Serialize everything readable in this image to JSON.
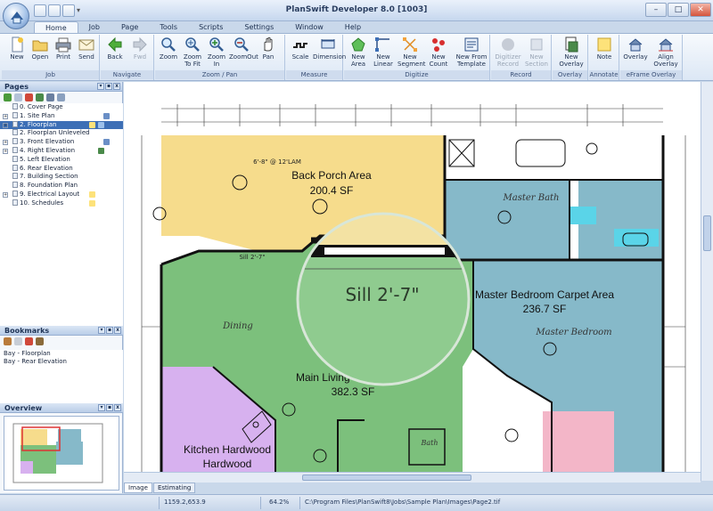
{
  "window": {
    "title": "PlanSwift Developer 8.0   [1003]",
    "minimize_label": "–",
    "maximize_label": "□",
    "close_label": "✕"
  },
  "tabs": [
    "Home",
    "Job",
    "Page",
    "Tools",
    "Scripts",
    "Settings",
    "Window",
    "Help"
  ],
  "ribbon": {
    "groups": {
      "job": "Job",
      "navigate": "Navigate",
      "zoompan": "Zoom / Pan",
      "measure": "Measure",
      "digitize": "Digitize",
      "record": "Record",
      "overlay": "Overlay",
      "annotate": "Annotate",
      "eframe": "eFrame Overlay"
    },
    "buttons": {
      "new": "New",
      "open": "Open",
      "print": "Print",
      "send": "Send",
      "back": "Back",
      "fwd": "Fwd",
      "zoom": "Zoom",
      "zoom_to_fit": "Zoom To Fit",
      "zoom_in": "Zoom In",
      "zoom_out": "ZoomOut",
      "pan": "Pan",
      "scale": "Scale",
      "dimension": "Dimension",
      "new_area": "New Area",
      "new_linear": "New Linear",
      "new_segment": "New Segment",
      "new_count": "New Count",
      "new_from_template": "New From Template",
      "digitizer_record": "Digitizer Record",
      "new_section": "New Section",
      "new_overlay": "New Overlay",
      "note": "Note",
      "overlay": "Overlay",
      "align_overlay": "Align Overlay"
    }
  },
  "pages_panel": {
    "title": "Pages",
    "items": [
      "0. Cover Page",
      "1. Site Plan",
      "2. Floorplan",
      "2. Floorplan Unleveled",
      "3. Front Elevation",
      "4. Right Elevation",
      "5. Left Elevation",
      "6. Rear Elevation",
      "7. Building Section",
      "8. Foundation Plan",
      "9. Electrical Layout",
      "10. Schedules"
    ]
  },
  "bookmarks_panel": {
    "title": "Bookmarks",
    "items": [
      "Bay - Floorplan",
      "Bay - Rear Elevation"
    ]
  },
  "overview_panel": {
    "title": "Overview"
  },
  "canvas": {
    "areas": [
      {
        "name": "Back Porch Area",
        "value": "200.4 SF"
      },
      {
        "name": "Master Bedroom Carpet Area",
        "value": "236.7 SF"
      },
      {
        "name": "Main Living Carpet Area",
        "value": "382.3 SF"
      },
      {
        "name": "Kitchen Hardwood",
        "value": ""
      }
    ],
    "magnifier_text": "Sill 2'-7\"",
    "plan_labels": {
      "master_bath": "Master Bath",
      "master_bedroom": "Master Bedroom",
      "dining": "Dining",
      "bath": "Bath",
      "porch_dim": "6'-8\" @ 12'LAM",
      "sill": "Sill 2'-7\""
    }
  },
  "bottom_tabs": [
    "Image",
    "Estimating"
  ],
  "status": {
    "coords": "1159.2,653.9",
    "zoom": "64.2%",
    "path": "C:\\Program Files\\PlanSwift8\\Jobs\\Sample Plan\\Images\\Page2.tif"
  },
  "colors": {
    "porch_area": "#f6dc8c",
    "living_area": "#7cc07c",
    "bedroom_area": "#86b9c9",
    "kitchen_area": "#d7b1ef",
    "selected_row": "#3d6fb6"
  }
}
